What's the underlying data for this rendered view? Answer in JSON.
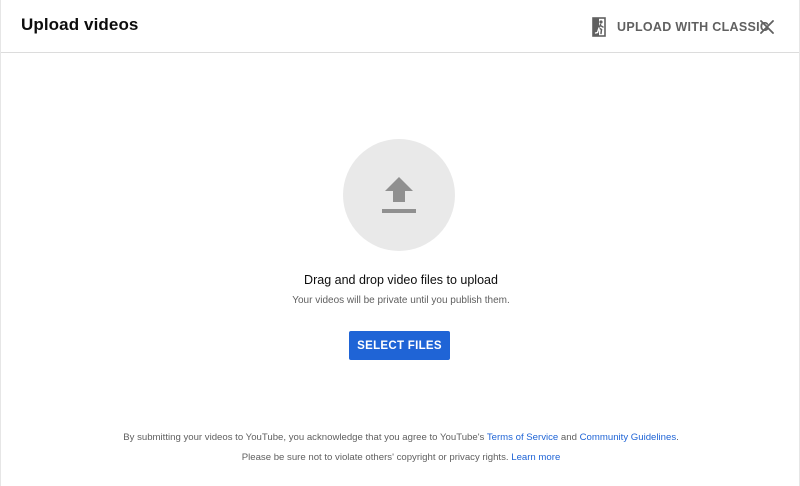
{
  "dialog": {
    "title": "Upload videos",
    "classic_label": "UPLOAD WITH CLASSIC",
    "classic_icon": "exit-door-icon",
    "close_icon": "close-icon"
  },
  "dropzone": {
    "icon": "upload-arrow-icon",
    "main_text": "Drag and drop video files to upload",
    "sub_text": "Your videos will be private until you publish them.",
    "button_label": "SELECT FILES",
    "accent_color": "#1f64d6"
  },
  "footer": {
    "line1_prefix": "By submitting your videos to YouTube, you acknowledge that you agree to YouTube's ",
    "tos_link": "Terms of Service",
    "and_text": " and ",
    "guidelines_link": "Community Guidelines",
    "line1_suffix": ".",
    "line2_prefix": "Please be sure not to violate others' copyright or privacy rights. ",
    "learn_more_link": "Learn more"
  }
}
